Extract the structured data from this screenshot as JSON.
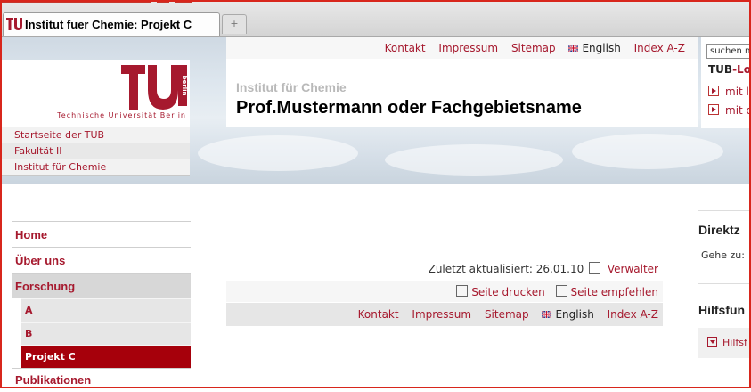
{
  "browser": {
    "tab_title": "Institut fuer Chemie: Projekt C",
    "new_tab_symbol": "+"
  },
  "logo": {
    "wordmark": "Technische Universität Berlin",
    "mark_side_text": "berlin"
  },
  "breadcrumbs": [
    "Startseite der TUB",
    "Fakultät II",
    "Institut für Chemie"
  ],
  "top_nav": {
    "links": [
      "Kontakt",
      "Impressum",
      "Sitemap"
    ],
    "language": "English",
    "index": "Index A-Z"
  },
  "header": {
    "subtitle": "Institut für Chemie",
    "title": "Prof.Mustermann oder Fachgebietsname"
  },
  "right_panel": {
    "search_placeholder": "suchen n",
    "tub_lo_prefix": "TUB",
    "tub_lo_suffix": "-Lo",
    "links": [
      "mit l",
      "mit d"
    ]
  },
  "left_menu": {
    "items": [
      "Home",
      "Über uns",
      "Forschung"
    ],
    "sub_items": [
      "A",
      "B",
      "Projekt C"
    ],
    "after": "Publikationen"
  },
  "content": {
    "updated_label": "Zuletzt aktualisiert: 26.01.10",
    "admin_link": "Verwalter",
    "print_link": "Seite drucken",
    "recommend_link": "Seite empfehlen"
  },
  "bottom_nav": {
    "links": [
      "Kontakt",
      "Impressum",
      "Sitemap"
    ],
    "language": "English",
    "index": "Index A-Z"
  },
  "right_column": {
    "direkt_heading": "Direktz",
    "gehe_label": "Gehe zu:",
    "hilfs_heading": "Hilfsfun",
    "hilfs_item": "Hilfsf"
  },
  "colors": {
    "brand_red": "#a6192e",
    "active_sub_bg": "#a6000b",
    "window_border": "#d8261c"
  }
}
